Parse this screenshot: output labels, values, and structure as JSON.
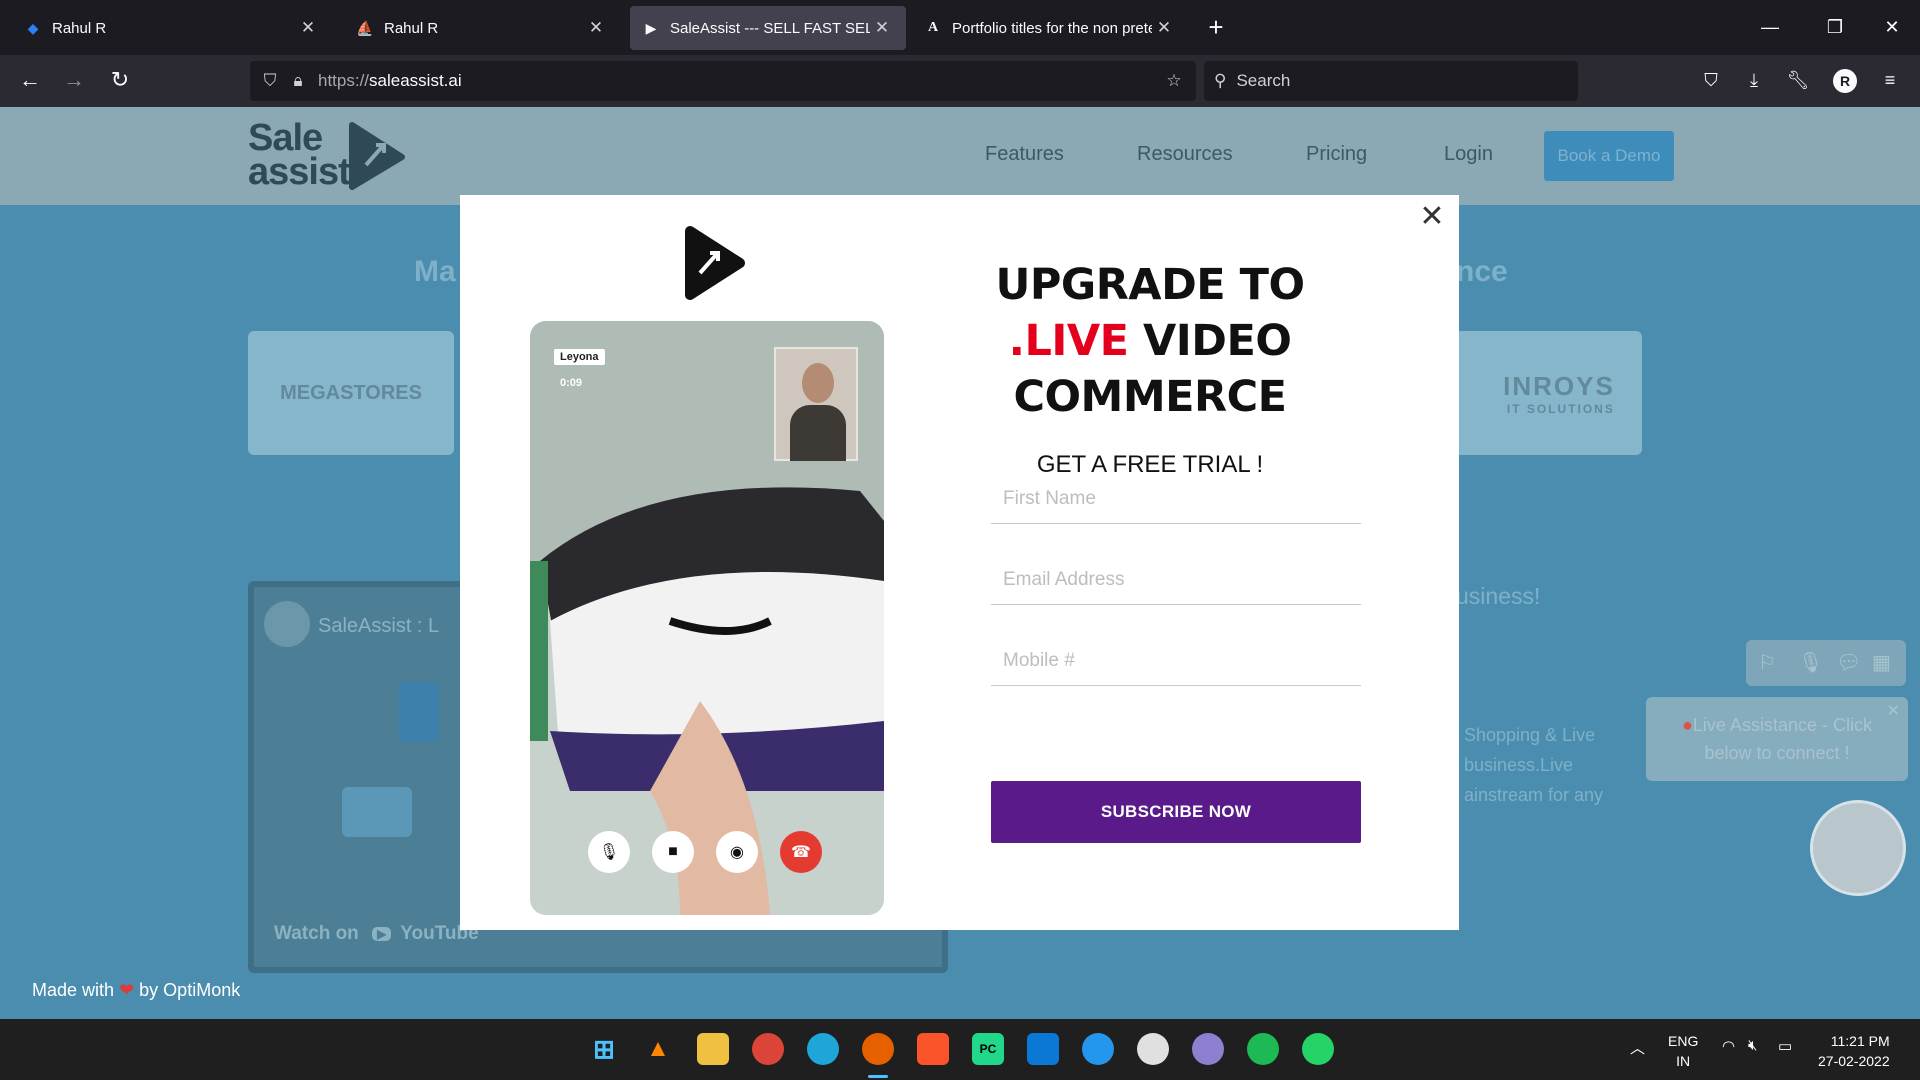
{
  "browser": {
    "tabs": [
      {
        "title": "Rahul R",
        "favicon": "blue-diamond-icon",
        "active": false
      },
      {
        "title": "Rahul R",
        "favicon": "ship-icon",
        "active": false
      },
      {
        "title": "SaleAssist --- SELL FAST SELL LIVE",
        "favicon": "saleassist-play-icon",
        "active": true
      },
      {
        "title": "Portfolio titles for the non pretentious",
        "favicon": "letter-a-icon",
        "active": false
      }
    ],
    "url_protocol": "https://",
    "url_domain": "saleassist.ai",
    "search_placeholder": "Search",
    "profile_initial": "R"
  },
  "site": {
    "logo_line1": "Sale",
    "logo_line2": "assist",
    "nav": [
      "Features",
      "Resources",
      "Pricing",
      "Login"
    ],
    "demo_button": "Book a Demo",
    "heading_left": "Ma",
    "heading_right": "nce",
    "logo_card_left": "MEGASTORES",
    "logo_card_right": "INROYS",
    "logo_card_right_sub": "IT SOLUTIONS",
    "video_title": "SaleAssist : L",
    "video_watch": "Watch on",
    "video_platform": "YouTube",
    "business_text": "usiness!",
    "body_lines": [
      "Shopping & Live",
      "business.Live",
      "ainstream for any"
    ],
    "live_assistance": "Live Assistance - Click below to connect !"
  },
  "modal": {
    "headline_1": "UPGRADE TO",
    "headline_live": ".LIVE",
    "headline_2": "VIDEO",
    "headline_3": "COMMERCE",
    "subheadline": "GET A FREE TRIAL !",
    "first_name_placeholder": "First Name",
    "email_placeholder": "Email Address",
    "mobile_placeholder": "Mobile #",
    "subscribe_label": "SUBSCRIBE NOW",
    "caller_name": "Leyona",
    "call_timer": "0:09"
  },
  "footer": {
    "made_with": "Made with",
    "by": "by OptiMonk"
  },
  "taskbar": {
    "lang_1": "ENG",
    "lang_2": "IN",
    "time": "11:21 PM",
    "date": "27-02-2022"
  },
  "colors": {
    "accent_purple": "#5a1a8a",
    "live_red": "#e4001c",
    "page_blue": "#4a8daf"
  }
}
